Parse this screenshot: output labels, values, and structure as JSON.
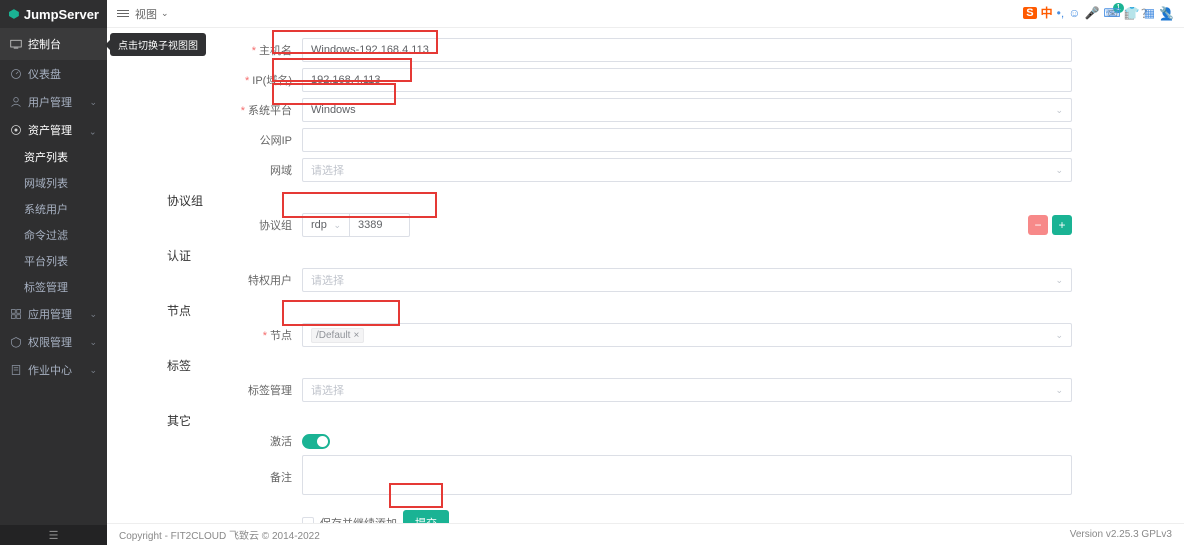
{
  "app": {
    "name": "JumpServer",
    "logo_initial": "J"
  },
  "topbar": {
    "view_label": "视图",
    "notification_count": "1"
  },
  "tooltip": "点击切换子视图图",
  "sidebar": {
    "console": "控制台",
    "dashboard": "仪表盘",
    "users": "用户管理",
    "assets": "资产管理",
    "assets_children": {
      "asset_list": "资产列表",
      "domain_list": "网域列表",
      "system_users": "系统用户",
      "cmd_filter": "命令过滤",
      "platform_list": "平台列表",
      "label_mgmt": "标签管理"
    },
    "apps": "应用管理",
    "perms": "权限管理",
    "jobs": "作业中心"
  },
  "form": {
    "hostname_label": "主机名",
    "hostname_value": "Windows-192.168.4.113",
    "ip_label": "IP(域名)",
    "ip_value": "192.168.4.113",
    "platform_label": "系统平台",
    "platform_value": "Windows",
    "public_ip_label": "公网IP",
    "domain_label": "网域",
    "select_placeholder": "请选择",
    "protocol_section": "协议组",
    "protocol_label": "协议组",
    "protocol_name": "rdp",
    "protocol_port": "3389",
    "auth_section": "认证",
    "privileged_label": "特权用户",
    "node_section": "节点",
    "node_label": "节点",
    "node_value": "/Default",
    "label_section": "标签",
    "label_mgmt_label": "标签管理",
    "other_section": "其它",
    "active_label": "激活",
    "remark_label": "备注",
    "save_continue": "保存并继续添加",
    "submit": "提交"
  },
  "footer": {
    "copyright": "Copyright - FIT2CLOUD 飞致云 © 2014-2022",
    "version": "Version v2.25.3 GPLv3"
  },
  "ime": {
    "brand": "S",
    "lang": "中"
  }
}
